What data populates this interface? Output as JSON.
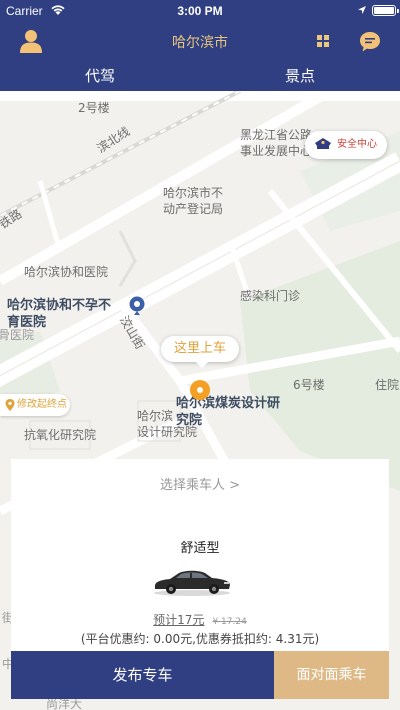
{
  "status_bar": {
    "carrier": "Carrier",
    "time": "3:00 PM"
  },
  "header": {
    "city": "哈尔滨市"
  },
  "tabs": [
    {
      "label": "代驾"
    },
    {
      "label": "景点"
    }
  ],
  "map": {
    "safety_center": "安全中心",
    "pickup_here": "这里上车",
    "modify_destination": "修改起终点",
    "labels": {
      "building_2": "2号楼",
      "binbei_line": "滨北线",
      "railway_road": "铁路",
      "hlj_office_line1": "黑龙江省公路",
      "hlj_office_line2": "事业发展中心",
      "property_line1": "哈尔滨市不",
      "property_line2": "动产登记局",
      "xiehe_hospital": "哈尔滨协和医院",
      "infertility_line1": "哈尔滨协和不孕不",
      "infertility_line2": "育医院",
      "infection_clinic": "感染科门诊",
      "jiaoshan_street": "洨山街",
      "building_6": "6号楼",
      "residence": "住院",
      "coal_institute_line1": "哈尔滨煤炭设计研",
      "coal_institute_line2": "究院",
      "design_line1": "哈尔滨",
      "design_line2": "设计研究院",
      "antioxidant": "抗氧化研究院",
      "hospital_fragment": "骨医院",
      "street_fragment": "街",
      "partial_street": "中",
      "partial_bottom": "尚洋大"
    }
  },
  "booking": {
    "select_passenger": "选择乘车人 >",
    "car_type": "舒适型",
    "estimated_price": "预计17元",
    "original_price": "¥ 17.24",
    "discount_text": "(平台优惠约: 0.00元,优惠券抵扣约: 4.31元)"
  },
  "actions": {
    "publish": "发布专车",
    "face_to_face": "面对面乘车"
  },
  "colors": {
    "primary": "#2f3f82",
    "accent": "#dfb985",
    "title": "#e9c57d"
  }
}
